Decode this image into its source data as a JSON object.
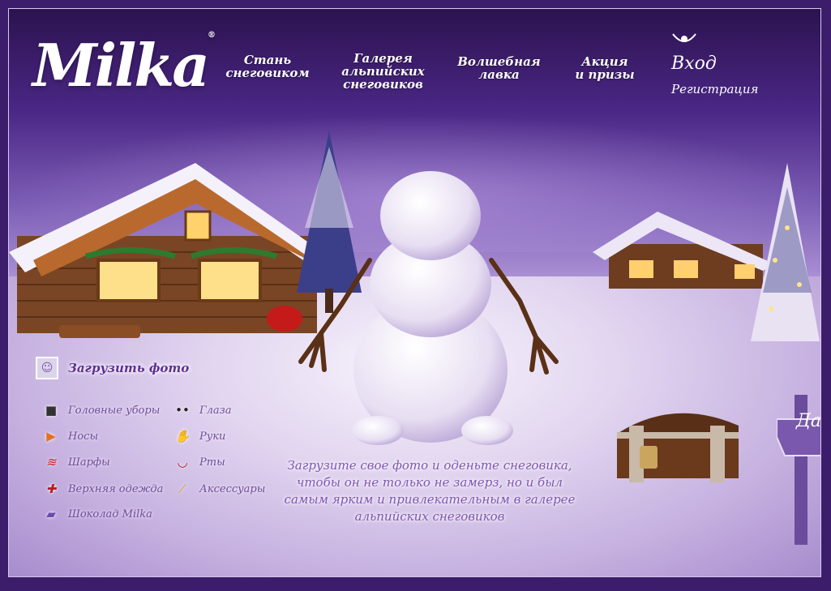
{
  "brand": {
    "logo_text": "Milka"
  },
  "nav": {
    "items": [
      {
        "label": "Стань\nснеговиком"
      },
      {
        "label": "Галерея\nальпийских\nснеговиков"
      },
      {
        "label": "Волшебная\nлавка"
      },
      {
        "label": "Акция\nи призы"
      }
    ],
    "login_label": "Вход",
    "register_label": "Регистрация",
    "login_icon": "cow-icon"
  },
  "upload": {
    "label": "Загрузить фото",
    "icon": "photo-icon"
  },
  "categories": [
    {
      "label": "Головные уборы",
      "icon": "hat-icon"
    },
    {
      "label": "Носы",
      "icon": "carrot-nose-icon"
    },
    {
      "label": "Шарфы",
      "icon": "scarf-icon"
    },
    {
      "label": "Верхняя одежда",
      "icon": "coat-icon"
    },
    {
      "label": "Шоколад Milka",
      "icon": "chocolate-icon"
    },
    {
      "label": "Глаза",
      "icon": "eyes-icon"
    },
    {
      "label": "Руки",
      "icon": "mitten-icon"
    },
    {
      "label": "Рты",
      "icon": "mouth-icon"
    },
    {
      "label": "Аксессуары",
      "icon": "accessory-icon"
    }
  ],
  "caption": "Загрузите свое фото и оденьте снеговика,\nчтобы он не только не замерз, но и был\nсамым ярким и привлекательным в галерее\nальпийских снеговиков",
  "sign": {
    "label": "Да"
  },
  "colors": {
    "brand_purple": "#5d2f96",
    "text_purple": "#7f55b3"
  }
}
